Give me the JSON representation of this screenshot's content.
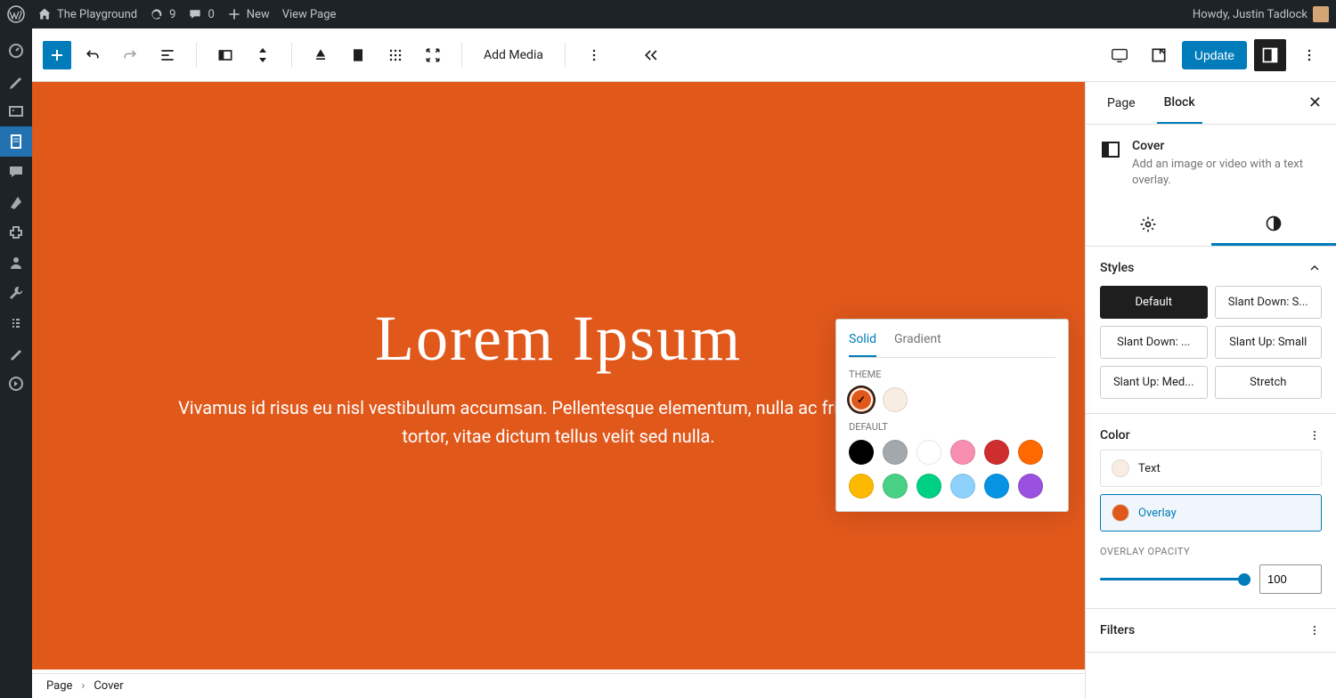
{
  "adminBar": {
    "siteName": "The Playground",
    "updates": "9",
    "comments": "0",
    "new": "New",
    "viewPage": "View Page",
    "howdy": "Howdy, Justin Tadlock"
  },
  "toolbar": {
    "addMedia": "Add Media",
    "update": "Update"
  },
  "cover": {
    "title": "Lorem Ipsum",
    "text": "Vivamus id risus eu nisl vestibulum accumsan. Pellentesque elementum, nulla ac fringilla aliquet tortor, vitae dictum tellus velit sed nulla."
  },
  "sidebar": {
    "tabs": {
      "page": "Page",
      "block": "Block"
    },
    "blockName": "Cover",
    "blockDesc": "Add an image or video with a text overlay.",
    "stylesHeading": "Styles",
    "styles": [
      "Default",
      "Slant Down: S...",
      "Slant Down: ...",
      "Slant Up: Small",
      "Slant Up: Med...",
      "Stretch"
    ],
    "colorHeading": "Color",
    "textLabel": "Text",
    "overlayLabel": "Overlay",
    "opacityLabel": "OVERLAY OPACITY",
    "opacityValue": "100",
    "filtersHeading": "Filters"
  },
  "popover": {
    "solid": "Solid",
    "gradient": "Gradient",
    "theme": "THEME",
    "default": "DEFAULT",
    "themeColors": [
      "#e1581b",
      "#f7ede2"
    ],
    "defaultColors": [
      "#000000",
      "#a3a8ad",
      "#ffffff",
      "#f88fb0",
      "#cf2e2e",
      "#ff6900",
      "#fcb900",
      "#48d084",
      "#00d084",
      "#8ed1fc",
      "#0693e3",
      "#9b51e0"
    ]
  },
  "breadcrumb": {
    "page": "Page",
    "block": "Cover"
  }
}
